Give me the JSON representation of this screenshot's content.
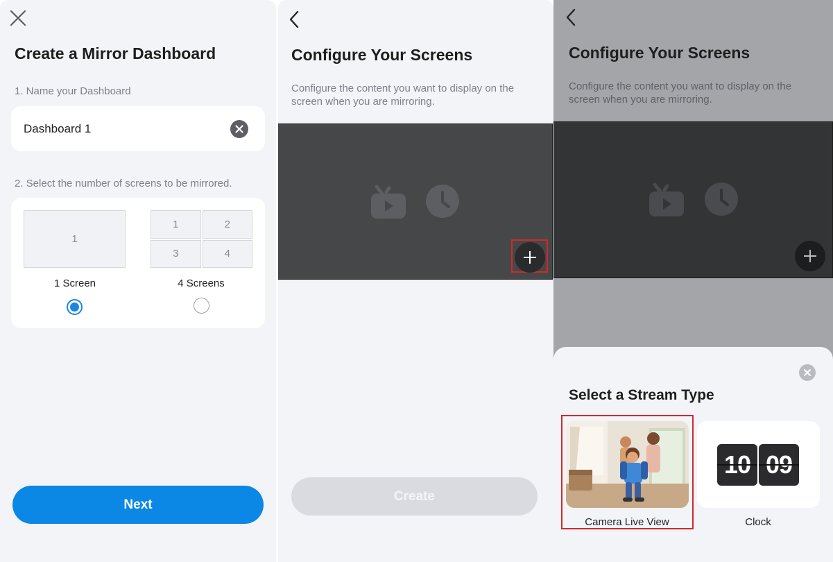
{
  "panel1": {
    "title": "Create a Mirror Dashboard",
    "step1_label": "1.  Name your Dashboard",
    "dashboard_name": "Dashboard 1",
    "step2_label": "2.  Select the number of screens to be mirrored.",
    "options": [
      {
        "label": "1 Screen",
        "cells": [
          "1"
        ],
        "selected": true
      },
      {
        "label": "4 Screens",
        "cells": [
          "1",
          "2",
          "3",
          "4"
        ],
        "selected": false
      }
    ],
    "next_label": "Next"
  },
  "panel2": {
    "title": "Configure Your Screens",
    "description": "Configure the content you want to display on the screen when you are mirroring.",
    "create_label": "Create"
  },
  "panel3": {
    "title": "Configure Your Screens",
    "description": "Configure the content you want to display on the screen when you are mirroring.",
    "sheet_title": "Select a Stream Type",
    "streams": [
      {
        "label": "Camera Live View"
      },
      {
        "label": "Clock",
        "hours": "10",
        "minutes": "09"
      }
    ]
  },
  "colors": {
    "accent": "#0b87e5",
    "highlight": "#d02a2a",
    "background": "#f3f4f8"
  }
}
